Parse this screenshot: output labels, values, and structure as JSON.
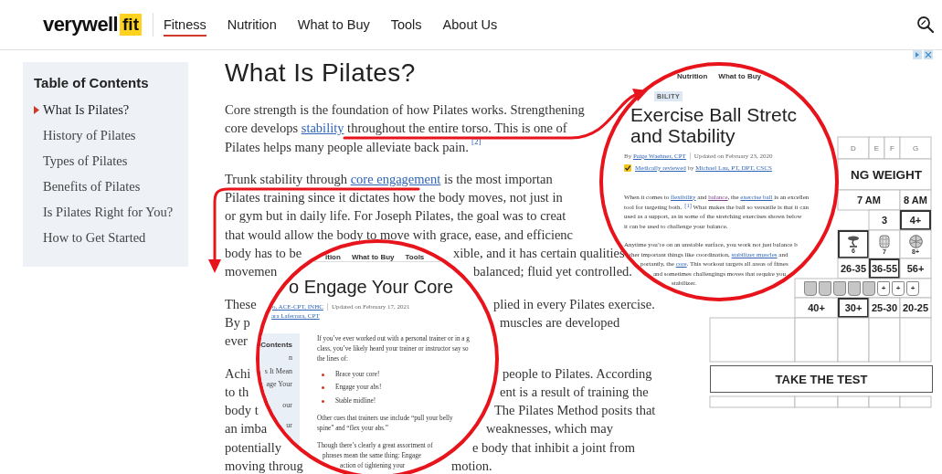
{
  "header": {
    "logo": {
      "word": "verywell",
      "badge": "fit"
    },
    "nav": [
      {
        "label": "Fitness",
        "selected": true
      },
      {
        "label": "Nutrition",
        "selected": false
      },
      {
        "label": "What to Buy",
        "selected": false
      },
      {
        "label": "Tools",
        "selected": false
      },
      {
        "label": "About Us",
        "selected": false
      }
    ]
  },
  "toc": {
    "title": "Table of Contents",
    "items": [
      {
        "label": "What Is Pilates?",
        "selected": true
      },
      {
        "label": "History of Pilates",
        "selected": false
      },
      {
        "label": "Types of Pilates",
        "selected": false
      },
      {
        "label": "Benefits of Pilates",
        "selected": false
      },
      {
        "label": "Is Pilates Right for You?",
        "selected": false
      },
      {
        "label": "How to Get Started",
        "selected": false
      }
    ]
  },
  "article": {
    "title": "What Is Pilates?",
    "paragraphs": [
      {
        "lines": [
          {
            "left": [
              "Core strength is the foundation of how Pilates works. Strengthening"
            ]
          },
          {
            "left": [
              "core develops ",
              {
                "text": "stability",
                "kind": "link"
              },
              " throughout the entire torso. This is one of"
            ]
          },
          {
            "left": [
              "Pilates helps many people alleviate back pain.",
              {
                "text": "[2]",
                "kind": "ref"
              }
            ]
          }
        ]
      },
      {
        "lines": [
          {
            "left": [
              "Trunk stability through ",
              {
                "text": "core engagement",
                "kind": "link"
              },
              " is the most importan"
            ]
          },
          {
            "left": [
              "Pilates training since it dictates how the body moves, not just in"
            ]
          },
          {
            "left": [
              "or gym but in daily life. For Joseph Pilates, the goal was to creat"
            ]
          },
          {
            "left": [
              "that would allow the body to move with grace, ease, and efficienc"
            ]
          },
          {
            "left": [
              "body has to be"
            ],
            "right": [
              "xible, and it has certain qualities"
            ]
          },
          {
            "left": [
              "movemen"
            ],
            "right": [
              "balanced; fluid yet controlled."
            ]
          }
        ]
      },
      {
        "lines": [
          {
            "left": [
              "These"
            ],
            "right": [
              "plied in every Pilates exercise."
            ]
          },
          {
            "left": [
              "By p"
            ],
            "right": [
              "muscles are developed"
            ]
          },
          {
            "left": [
              "ever"
            ]
          }
        ]
      },
      {
        "lines": [
          {
            "left": [
              "Achi"
            ],
            "right": [
              "people to Pilates. According"
            ]
          },
          {
            "left": [
              "to th"
            ],
            "right": [
              "ent is a result of training the"
            ]
          },
          {
            "left": [
              "body t"
            ],
            "right": [
              "The Pilates Method posits that"
            ]
          },
          {
            "left": [
              "an imba"
            ],
            "right": [
              "weaknesses, which may"
            ]
          },
          {
            "left": [
              "potentially"
            ],
            "right": [
              "e body that inhibit a joint from"
            ]
          },
          {
            "left": [
              "moving throug"
            ],
            "right": [
              "motion."
            ]
          }
        ]
      }
    ]
  },
  "test_widget": {
    "rows": [
      {
        "kind": "letters",
        "cells": [
          {
            "text": "D"
          },
          {
            "text": "E"
          },
          {
            "text": "F"
          },
          {
            "text": "G"
          }
        ]
      },
      {
        "kind": "title",
        "cells": [
          {
            "text": "NG WEIGHT"
          }
        ]
      },
      {
        "kind": "times",
        "cells": [
          {
            "text": "7 AM",
            "selected": false
          },
          {
            "text": "8 AM",
            "selected": false
          }
        ]
      },
      {
        "kind": "text",
        "cells": [
          {
            "text": "3",
            "selected": false
          },
          {
            "text": "4+",
            "selected": true
          }
        ]
      },
      {
        "kind": "icons",
        "cells": [
          {
            "text": "6",
            "selected": true
          },
          {
            "text": "7",
            "selected": false
          },
          {
            "text": "8+",
            "selected": false
          }
        ]
      },
      {
        "kind": "text",
        "cells": [
          {
            "text": "26-35",
            "selected": false
          },
          {
            "text": "36-55",
            "selected": true
          },
          {
            "text": "56+",
            "selected": false
          }
        ]
      },
      {
        "kind": "cups",
        "cups": [
          {
            "filled": true
          },
          {
            "filled": true
          },
          {
            "filled": true
          },
          {
            "filled": true
          },
          {
            "filled": true
          },
          {
            "filled": false,
            "label": "+"
          },
          {
            "filled": false,
            "label": "+"
          },
          {
            "filled": false,
            "label": "+"
          }
        ]
      },
      {
        "kind": "text",
        "cells": [
          {
            "text": "40+",
            "selected": false
          },
          {
            "text": "30+",
            "selected": true
          },
          {
            "text": "25-30",
            "selected": false
          },
          {
            "text": "20-25",
            "selected": false
          }
        ]
      }
    ],
    "button": "TAKE THE TEST"
  },
  "excerpt_core": {
    "nav": [
      "ition",
      "What to Buy",
      "Tools"
    ],
    "title": "o Engage Your Core",
    "byline": [
      {
        "text": "o, ACE-CPT, INHC",
        "kind": "link"
      }
    ],
    "updated": "Updated on February 17, 2021",
    "byline2": [
      {
        "text": "ara Laferrara, CPT",
        "kind": "link"
      }
    ],
    "sidebar": {
      "title": "Contents",
      "items": [
        "n",
        "s It Mean",
        "age Your",
        "our",
        "ur"
      ]
    },
    "intro": [
      "If you’ve ever worked out with a personal trainer or in a g",
      "class, you’ve likely heard your trainer or instructor say so",
      "the lines of:"
    ],
    "bullets": [
      "Brace your core!",
      "Engage your abs!",
      "Stable midline!"
    ],
    "cues": [
      "Other cues that trainers use include “pull your belly",
      "spine” and “flex your abs.”"
    ],
    "outro": [
      "Though there’s clearly a great assortment of",
      "phrases mean the same thing: Engage",
      "action of tightening your"
    ]
  },
  "excerpt_ball": {
    "nav": [
      "Nutrition",
      "What to Buy"
    ],
    "tag": "BILITY",
    "title_lines": [
      "Exercise Ball Stretc",
      "and Stability"
    ],
    "byline": [
      "By ",
      {
        "text": "Paige Waehner, CPT",
        "kind": "link"
      }
    ],
    "updated": "Updated on February 23, 2020",
    "review": [
      {
        "text": "Medically reviewed",
        "kind": "link"
      },
      " by ",
      {
        "text": "Michael Lau, PT, DPT, CSCS",
        "kind": "link"
      }
    ],
    "paragraphs": [
      [
        [
          "When it comes to ",
          {
            "text": "flexibility",
            "kind": "link"
          },
          " and ",
          {
            "text": "balance",
            "kind": "visited"
          },
          ", the ",
          {
            "text": "exercise ball",
            "kind": "link"
          },
          " is an excellen"
        ],
        [
          "tool for targeting both.",
          {
            "text": "[1]",
            "kind": "ref"
          },
          " What makes the ball so versatile is that it can"
        ],
        [
          "used as a support, as in some of the stretching exercises shown below"
        ],
        [
          "it can be used to challenge your balance."
        ]
      ],
      [
        [
          "Anytime you’re on an unstable surface, you work not just balance b"
        ],
        [
          "ther important things like coordination, ",
          {
            "text": "stabilizer muscles",
            "kind": "link"
          },
          " and"
        ],
        [
          "portantly, the ",
          {
            "text": "core",
            "kind": "link"
          },
          ". This workout targets all areas of fitnes"
        ],
        [
          "and sometimes challengings moves that require you"
        ],
        [
          "stabilizer."
        ]
      ]
    ]
  }
}
